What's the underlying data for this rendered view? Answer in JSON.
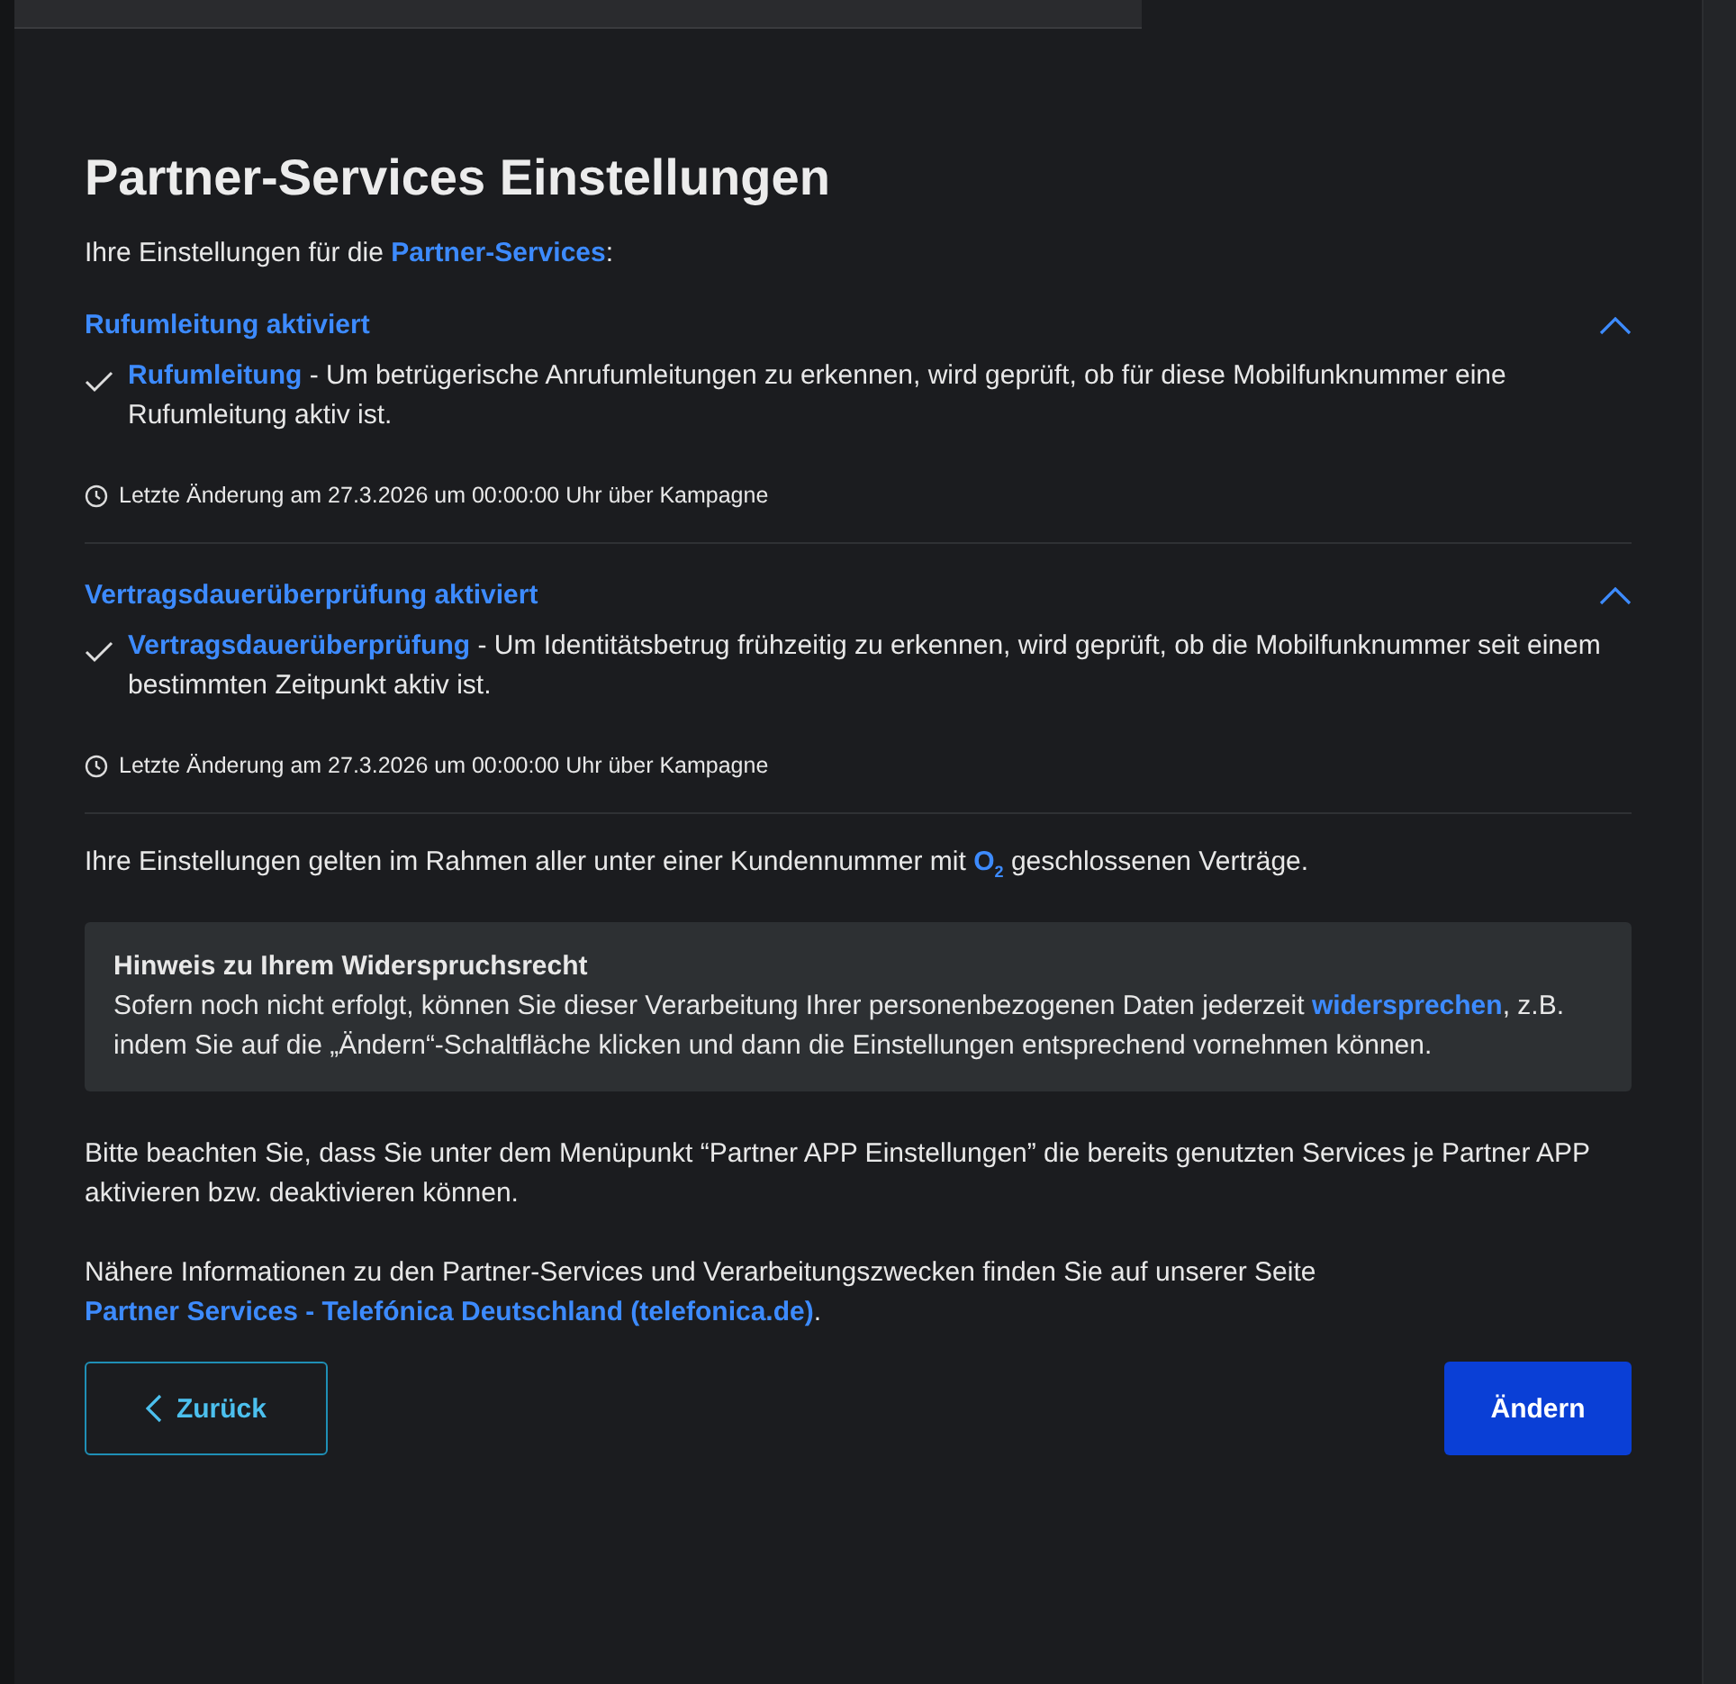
{
  "title": "Partner-Services Einstellungen",
  "intro": [
    {
      "text": "Ihre Einstellungen für die ",
      "link": false
    },
    {
      "text": "Partner-Services",
      "link": true
    },
    {
      "text": ":",
      "link": false
    }
  ],
  "sections": [
    {
      "heading": "Rufumleitung aktiviert",
      "expanded": true,
      "service": "Rufumleitung",
      "description": " - Um betrügerische Anrufumleitungen zu erkennen, wird geprüft, ob für diese Mobilfunknummer eine Rufumleitung aktiv ist.",
      "checked": true,
      "last_change": "Letzte Änderung am 27.3.2026 um 00:00:00 Uhr über Kampagne"
    },
    {
      "heading": "Vertragsdauerüberprüfung aktiviert",
      "expanded": true,
      "service": "Vertragsdauerüberprüfung",
      "description": " - Um Identitätsbetrug frühzeitig zu erkennen, wird geprüft, ob die Mobilfunknummer seit einem bestimmten Zeitpunkt aktiv ist.",
      "checked": true,
      "last_change": "Letzte Änderung am 27.3.2026 um 00:00:00 Uhr über Kampagne"
    }
  ],
  "scope": [
    {
      "text": "Ihre Einstellungen gelten im Rahmen aller unter einer Kundennummer mit ",
      "link": false
    },
    {
      "text": "O$_{2}$",
      "link": true
    },
    {
      "text": " geschlossenen Verträge.",
      "link": false
    }
  ],
  "notice": {
    "title": "Hinweis zu Ihrem Widerspruchsrecht",
    "body": [
      {
        "text": "Sofern noch nicht erfolgt, können Sie dieser Verarbeitung Ihrer personenbezogenen Daten jederzeit ",
        "link": false
      },
      {
        "text": "widersprechen",
        "link": true
      },
      {
        "text": ", z.B. indem Sie auf die „Ändern“-Schaltfläche klicken und dann die Einstellungen entsprechend vornehmen können.",
        "link": false
      }
    ]
  },
  "paragraphs": [
    [
      {
        "text": "Bitte beachten Sie, dass Sie unter dem Menüpunkt “Partner APP Einstellungen” die bereits genutzten Services je Partner APP aktivieren bzw. deaktivieren können.",
        "link": false
      }
    ],
    [
      {
        "text": "Nähere Informationen zu den Partner-Services und Verarbeitungszwecken finden Sie auf unserer Seite ",
        "link": false
      },
      {
        "text": "Partner Services - Telefónica Deutschland (telefonica.de)",
        "link": true
      },
      {
        "text": ".",
        "link": false
      }
    ]
  ],
  "buttons": [
    {
      "label": "Zurück",
      "kind": "secondary"
    },
    {
      "label": "Ändern",
      "kind": "primary"
    }
  ]
}
